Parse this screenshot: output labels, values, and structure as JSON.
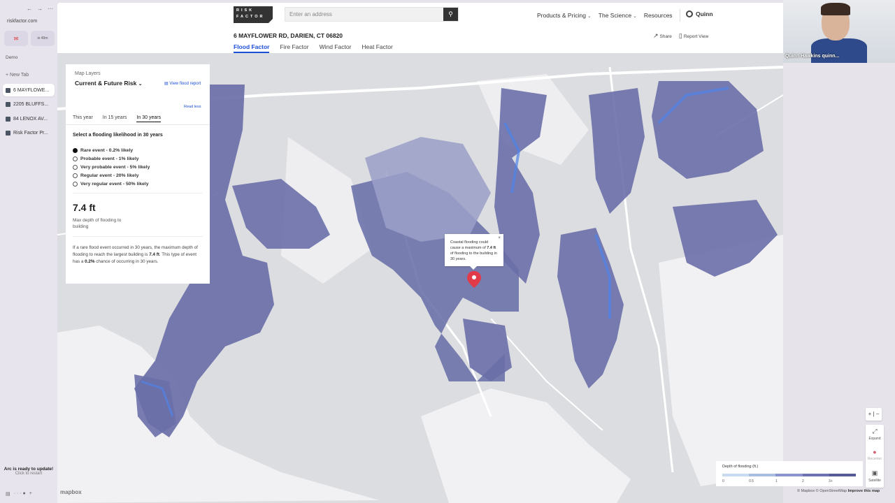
{
  "arc": {
    "url": "riskfactor.com",
    "pin_badge": "in 49m",
    "space": "Demo",
    "new_tab": "New Tab",
    "tabs": [
      "6 MAYFLOWE...",
      "2205 BLUFFS...",
      "84 LENOX AV...",
      "Risk Factor Pr..."
    ],
    "update_title": "Arc is ready to update!",
    "update_sub": "Click to restart"
  },
  "header": {
    "logo": "RISK FACTOR",
    "search_placeholder": "Enter an address",
    "menu": [
      "Products & Pricing",
      "The Science",
      "Resources"
    ],
    "user": "Quinn"
  },
  "subbar": {
    "address": "6 MAYFLOWER RD, DARIEN, CT 06820",
    "tabs": [
      "Flood Factor",
      "Fire Factor",
      "Wind Factor",
      "Heat Factor"
    ],
    "share": "Share",
    "report_view": "Report View"
  },
  "panel": {
    "map_layers": "Map Layers",
    "selector": "Current & Future Risk",
    "view_report": "View flood report",
    "read_less": "Read less",
    "year_tabs": [
      "This year",
      "In 15 years",
      "In 30 years"
    ],
    "question": "Select a flooding likelihood in 30 years",
    "options": [
      "Rare event - 0.2% likely",
      "Probable event - 1% likely",
      "Very probable event - 5% likely",
      "Regular event - 20% likely",
      "Very regular event - 50% likely"
    ],
    "max_depth": "7.4 ft",
    "max_depth_label": "Max depth of flooding to building",
    "desc_1": "If a rare flood event occurred in 30 years, the maximum depth of flooding to reach the largest building is ",
    "desc_depth": "7.4 ft",
    "desc_2": ". This type of event has a ",
    "desc_pct": "0.2%",
    "desc_3": " chance of occurring in 30 years."
  },
  "tooltip": {
    "text_1": "Coastal flooding could cause a maximum of ",
    "text_bold": "7.4 ft",
    "text_2": " of flooding to the building in 30 years.",
    "close": "×"
  },
  "legend": {
    "title": "Depth of flooding (ft.)",
    "ticks": [
      "0",
      "0.5",
      "1",
      "2",
      "3+"
    ],
    "colors": [
      "#c8dbf0",
      "#a9bee0",
      "#8a93cc",
      "#6e72b0",
      "#565a94"
    ]
  },
  "controls": {
    "zoom": "+ | −",
    "expand": "Expand",
    "recenter": "Recenter",
    "satellite": "Satellite"
  },
  "attribution": {
    "text": "© Mapbox © OpenStreetMap ",
    "improve": "Improve this map",
    "mapbox": "mapbox"
  },
  "video": {
    "name": "Quinn Hawkins quinn..."
  },
  "colors": {
    "accent": "#1d4ed8",
    "flood": "#6a6fa8",
    "flood_light": "#9aa0c8",
    "flood_edge": "#4f83e8",
    "land": "#dcdde0",
    "water": "#f4f4f6"
  }
}
